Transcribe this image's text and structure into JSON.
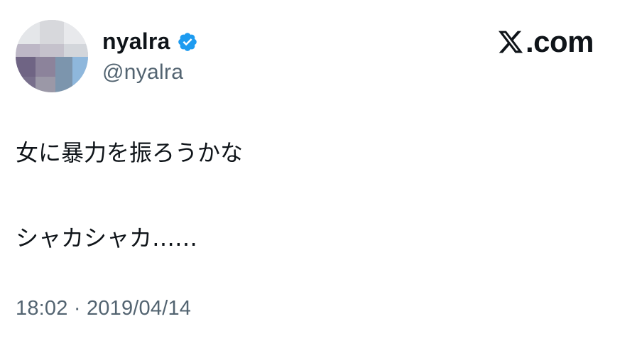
{
  "user": {
    "display_name": "nyalra",
    "handle": "@nyalra",
    "verified": true,
    "verified_color": "#1d9bf0"
  },
  "brand": {
    "mark": "X",
    "suffix": ".com"
  },
  "tweet": {
    "lines": [
      "女に暴力を振ろうかな",
      "シャカシャカ……"
    ],
    "time": "18:02",
    "separator": "·",
    "date": "2019/04/14"
  },
  "colors": {
    "text": "#0f1419",
    "secondary": "#536471",
    "background": "#ffffff"
  },
  "icons": {
    "verified": "verified-badge-icon",
    "brand": "x-logo-icon"
  }
}
